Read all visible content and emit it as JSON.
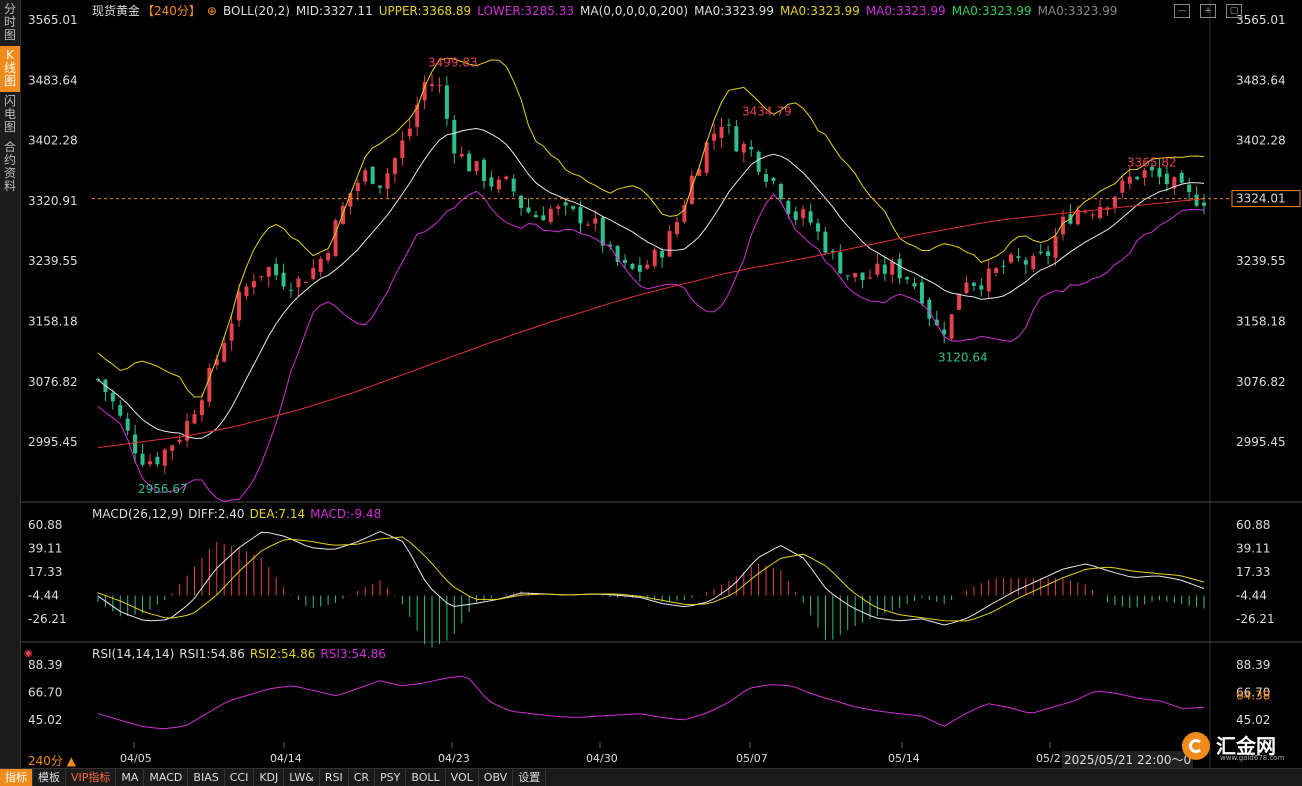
{
  "sidebar": {
    "tabs": [
      {
        "label": "分时图",
        "active": false
      },
      {
        "label": "K线图",
        "active": true
      },
      {
        "label": "闪电图",
        "active": false
      },
      {
        "label": "合约资料",
        "active": false
      }
    ]
  },
  "header": {
    "symbol": "现货黄金",
    "period": "【240分】",
    "boll": "BOLL(20,2)",
    "mid": "MID:3327.11",
    "upper": "UPPER:3368.89",
    "lower": "LOWER:3285.33",
    "ma_params": "MA(0,0,0,0,0,200)",
    "ma_values": [
      "MA0:3323.99",
      "MA0:3323.99",
      "MA0:3323.99",
      "MA0:3323.99",
      "MA0:3323.99"
    ]
  },
  "colors": {
    "up": "#e6414f",
    "down": "#2fbf8f",
    "upper": "#e5d31e",
    "mid": "#e8e8e8",
    "lower": "#d02fd6",
    "ma200": "#e03030",
    "accent": "#f08a1a"
  },
  "price_axis": {
    "ticks": [
      "3565.01",
      "3483.64",
      "3402.28",
      "3320.91",
      "3239.55",
      "3158.18",
      "3076.82",
      "2995.45"
    ],
    "current": "3324.01"
  },
  "annotations": {
    "high1": "3499.83",
    "high2": "3434.79",
    "high3": "3365.82",
    "low1": "2956.67",
    "low2": "3120.64"
  },
  "macd": {
    "legend": "MACD(26,12,9)",
    "diff": "DIFF:2.40",
    "dea": "DEA:7.14",
    "macd": "MACD:-9.48",
    "ticks": [
      "60.88",
      "39.11",
      "17.33",
      "-4.44",
      "-26.21"
    ]
  },
  "rsi": {
    "legend": "RSI(14,14,14)",
    "rsi1": "RSI1:54.86",
    "rsi2": "RSI2:54.86",
    "rsi3": "RSI3:54.86",
    "ticks": [
      "88.39",
      "66.70",
      "45.02"
    ],
    "current": "64.38"
  },
  "dates": [
    "04/05",
    "04/14",
    "04/23",
    "04/30",
    "05/07",
    "05/14",
    "05/2"
  ],
  "period_label": "240分 ▲",
  "timestamp": "2025/05/21 22:00～0",
  "bottom_tabs": [
    {
      "label": "指标",
      "cls": "active"
    },
    {
      "label": "模板",
      "cls": ""
    },
    {
      "label": "VIP指标",
      "cls": "vip"
    },
    {
      "label": "MA",
      "cls": ""
    },
    {
      "label": "MACD",
      "cls": ""
    },
    {
      "label": "BIAS",
      "cls": ""
    },
    {
      "label": "CCI",
      "cls": ""
    },
    {
      "label": "KDJ",
      "cls": ""
    },
    {
      "label": "LW&",
      "cls": ""
    },
    {
      "label": "RSI",
      "cls": ""
    },
    {
      "label": "CR",
      "cls": ""
    },
    {
      "label": "PSY",
      "cls": ""
    },
    {
      "label": "BOLL",
      "cls": ""
    },
    {
      "label": "VOL",
      "cls": ""
    },
    {
      "label": "OBV",
      "cls": ""
    },
    {
      "label": "设置",
      "cls": ""
    }
  ],
  "logo": {
    "name": "汇金网",
    "url": "www.gold678.com"
  },
  "chart_data": {
    "type": "candlestick",
    "price_ylim": [
      2956.67,
      3565.01
    ],
    "x": [
      "04/05",
      "04/14",
      "04/23",
      "04/30",
      "05/07",
      "05/14",
      "05/2"
    ],
    "close_series": [
      3080,
      3050,
      3010,
      2975,
      2970,
      2990,
      3010,
      3050,
      3090,
      3140,
      3190,
      3220,
      3230,
      3215,
      3210,
      3225,
      3250,
      3300,
      3340,
      3360,
      3345,
      3380,
      3420,
      3480,
      3480,
      3400,
      3370,
      3360,
      3340,
      3345,
      3310,
      3300,
      3310,
      3305,
      3300,
      3290,
      3250,
      3230,
      3225,
      3240,
      3260,
      3300,
      3360,
      3400,
      3430,
      3400,
      3390,
      3360,
      3340,
      3300,
      3300,
      3270,
      3240,
      3220,
      3215,
      3225,
      3230,
      3220,
      3200,
      3150,
      3150,
      3220,
      3210,
      3220,
      3235,
      3240,
      3235,
      3250,
      3290,
      3310,
      3310,
      3320,
      3335,
      3355,
      3360,
      3350,
      3340,
      3325,
      3324
    ],
    "ma200_series": [
      2988,
      2993,
      2998,
      3003,
      3010,
      3018,
      3028,
      3038,
      3050,
      3062,
      3076,
      3090,
      3104,
      3118,
      3132,
      3145,
      3158,
      3170,
      3182,
      3193,
      3203,
      3212,
      3222,
      3230,
      3237,
      3244,
      3252,
      3260,
      3268,
      3276,
      3283,
      3290,
      3296,
      3300,
      3304,
      3308,
      3312,
      3316,
      3320,
      3324
    ],
    "macd_ylim": [
      -35,
      65
    ],
    "diff_series": [
      -5,
      -20,
      -28,
      -27,
      -10,
      20,
      40,
      55,
      50,
      40,
      38,
      45,
      55,
      45,
      5,
      -15,
      -12,
      -8,
      -2,
      -3,
      -4,
      -3,
      -4,
      -6,
      -12,
      -15,
      -10,
      5,
      30,
      42,
      30,
      0,
      -15,
      -25,
      -28,
      -26,
      -32,
      -25,
      -12,
      0,
      10,
      20,
      25,
      18,
      12,
      14,
      10,
      2
    ],
    "dea_series": [
      -2,
      -10,
      -20,
      -26,
      -22,
      -5,
      18,
      38,
      48,
      46,
      42,
      43,
      48,
      50,
      30,
      5,
      -8,
      -8,
      -4,
      -3,
      -4,
      -3,
      -3,
      -5,
      -9,
      -13,
      -12,
      -3,
      15,
      30,
      34,
      22,
      0,
      -15,
      -22,
      -25,
      -28,
      -28,
      -20,
      -8,
      2,
      12,
      20,
      22,
      18,
      16,
      14,
      8
    ],
    "rsi_ylim": [
      35,
      95
    ],
    "rsi_series": [
      50,
      45,
      40,
      38,
      40,
      50,
      60,
      65,
      70,
      72,
      68,
      64,
      70,
      76,
      72,
      74,
      78,
      80,
      60,
      52,
      50,
      48,
      47,
      48,
      49,
      50,
      47,
      45,
      50,
      58,
      70,
      73,
      72,
      65,
      60,
      55,
      52,
      50,
      48,
      40,
      50,
      58,
      55,
      50,
      55,
      60,
      68,
      66,
      62,
      60,
      54,
      55
    ]
  }
}
